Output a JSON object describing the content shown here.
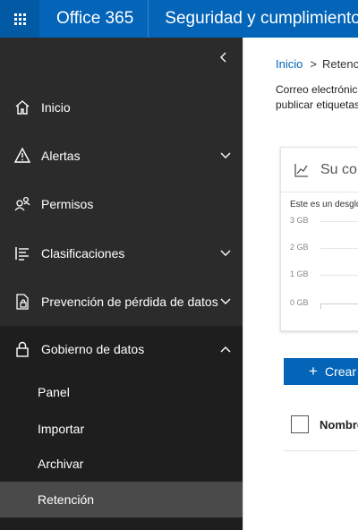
{
  "header": {
    "app_launcher_icon": "waffle-icon",
    "brand": "Office 365",
    "title": "Seguridad y cumplimiento"
  },
  "sidebar": {
    "collapse_icon": "chevron-left-icon",
    "items": [
      {
        "label": "Inicio",
        "icon": "home-icon"
      },
      {
        "label": "Alertas",
        "icon": "warning-icon",
        "expandable": true
      },
      {
        "label": "Permisos",
        "icon": "people-icon"
      },
      {
        "label": "Clasificaciones",
        "icon": "list-icon",
        "expandable": true
      },
      {
        "label": "Prevención de pérdida de datos",
        "icon": "lock-doc-icon",
        "expandable": true
      },
      {
        "label": "Gobierno de datos",
        "icon": "lock-icon",
        "expanded": true
      }
    ],
    "sub_items": [
      {
        "label": "Panel"
      },
      {
        "label": "Importar"
      },
      {
        "label": "Archivar"
      },
      {
        "label": "Retención",
        "active": true
      }
    ]
  },
  "main": {
    "breadcrumb": {
      "home": "Inicio",
      "separator": ">",
      "current": "Retención"
    },
    "description": [
      "Correo electrónico",
      "publicar etiquetas"
    ],
    "card": {
      "title": "Su consumo",
      "subtitle": "Este es un desglose",
      "y_labels": [
        "3 GB",
        "2 GB",
        "1 GB",
        "0 GB"
      ]
    },
    "create_button": "Crear",
    "table": {
      "column_name": "Nombre"
    }
  },
  "colors": {
    "accent": "#0364b8",
    "sidebar": "#2b2b2b",
    "sidebar_active": "#4a4a4a"
  }
}
